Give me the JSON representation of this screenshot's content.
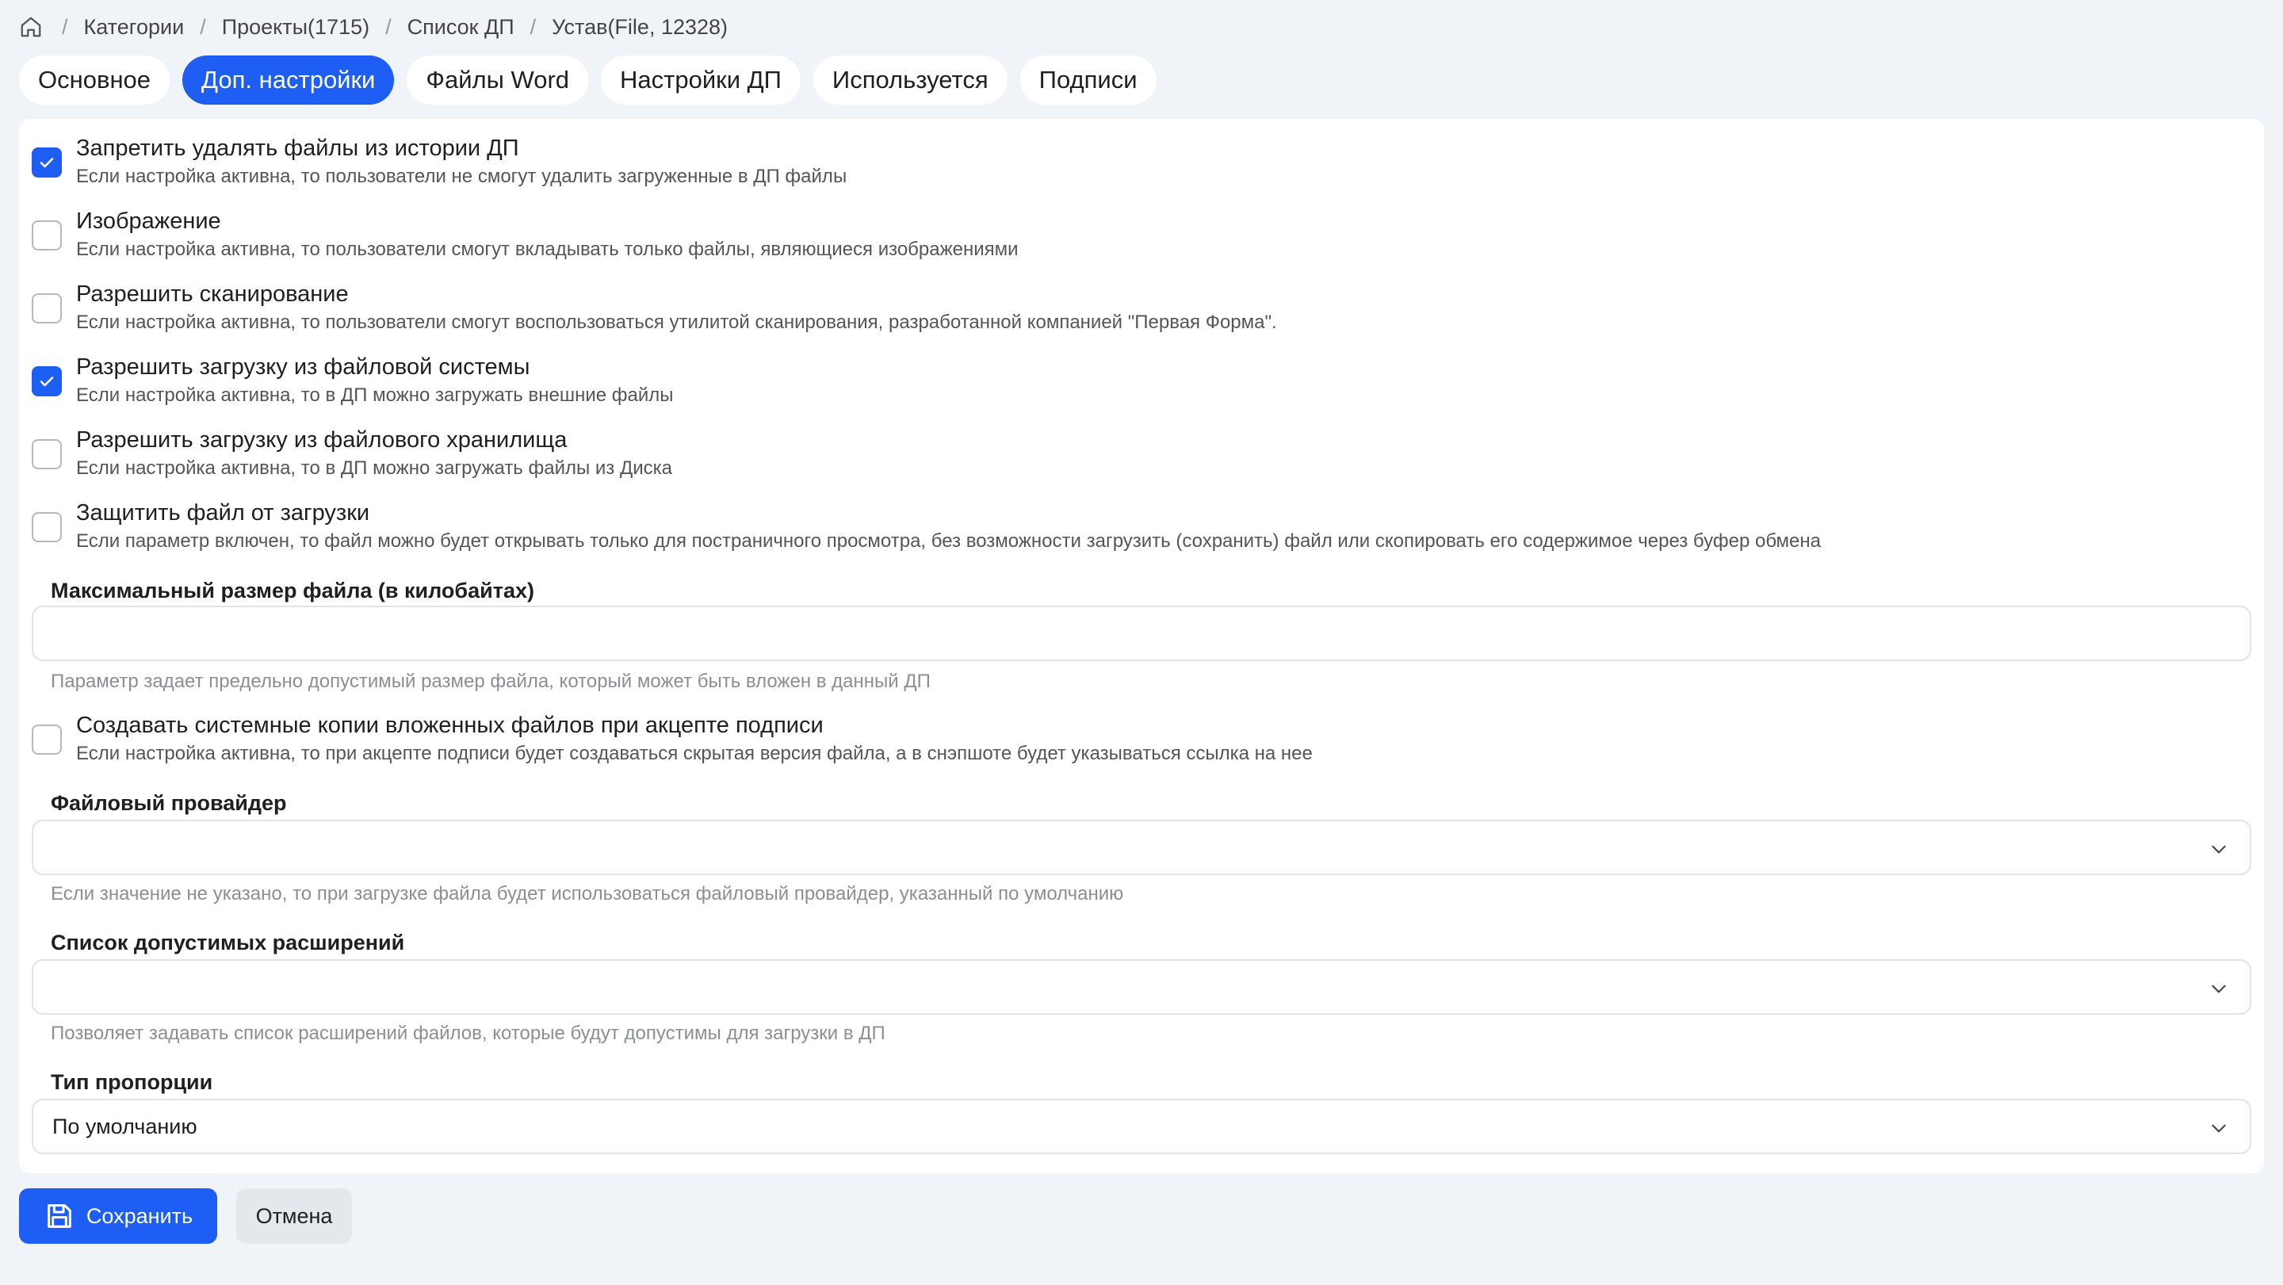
{
  "breadcrumb": {
    "items": [
      "Категории",
      "Проекты(1715)",
      "Список ДП",
      "Устав(File, 12328)"
    ],
    "separator": "/"
  },
  "tabs": [
    {
      "label": "Основное",
      "active": false
    },
    {
      "label": "Доп. настройки",
      "active": true
    },
    {
      "label": "Файлы Word",
      "active": false
    },
    {
      "label": "Настройки ДП",
      "active": false
    },
    {
      "label": "Используется",
      "active": false
    },
    {
      "label": "Подписи",
      "active": false
    }
  ],
  "settings": {
    "forbid_delete": {
      "label": "Запретить удалять файлы из истории ДП",
      "desc": "Если настройка активна, то пользователи не смогут удалить загруженные в ДП файлы",
      "checked": true
    },
    "image": {
      "label": "Изображение",
      "desc": "Если настройка активна, то пользователи смогут вкладывать только файлы, являющиеся изображениями",
      "checked": false
    },
    "scanning": {
      "label": "Разрешить сканирование",
      "desc": "Если настройка активна, то пользователи смогут воспользоваться утилитой сканирования, разработанной компанией \"Первая Форма\".",
      "checked": false
    },
    "fs_upload": {
      "label": "Разрешить загрузку из файловой системы",
      "desc": "Если настройка активна, то в ДП можно загружать внешние файлы",
      "checked": true
    },
    "storage_upload": {
      "label": "Разрешить загрузку из файлового хранилища",
      "desc": "Если настройка активна, то в ДП можно загружать файлы из Диска",
      "checked": false
    },
    "protect": {
      "label": "Защитить файл от загрузки",
      "desc": "Если параметр включен, то файл можно будет открывать только для постраничного просмотра, без возможности загрузить (сохранить) файл или скопировать его содержимое через буфер обмена",
      "checked": false
    },
    "system_copies": {
      "label": "Создавать системные копии вложенных файлов при акцепте подписи",
      "desc": "Если настройка активна, то при акцепте подписи будет создаваться скрытая версия файла, а в снэпшоте будет указываться  ссылка на нее",
      "checked": false
    }
  },
  "fields": {
    "max_size": {
      "label": "Максимальный размер файла (в килобайтах)",
      "value": "",
      "hint": "Параметр задает предельно допустимый размер файла, который может быть вложен в данный ДП"
    },
    "provider": {
      "label": "Файловый провайдер",
      "value": "",
      "hint": "Если значение не указано, то при загрузке файла будет использоваться файловый провайдер, указанный по умолчанию"
    },
    "extensions": {
      "label": "Список допустимых расширений",
      "value": "",
      "hint": "Позволяет задавать список расширений файлов, которые будут допустимы для загрузки в ДП"
    },
    "proportion": {
      "label": "Тип пропорции",
      "value": "По умолчанию"
    }
  },
  "buttons": {
    "save": "Сохранить",
    "cancel": "Отмена"
  },
  "colors": {
    "accent": "#1e5ef5",
    "background": "#f0f3f7"
  },
  "icons": {
    "home": "home-icon",
    "check": "check-icon",
    "chevron": "chevron-down-icon",
    "save": "floppy-disk-icon"
  }
}
